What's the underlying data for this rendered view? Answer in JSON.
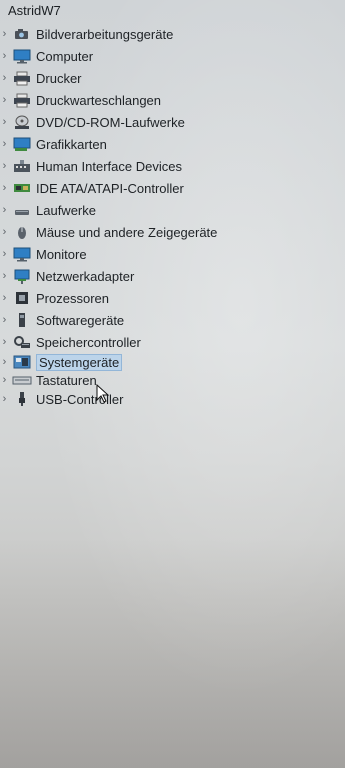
{
  "root": {
    "label": "AstridW7"
  },
  "nodes": [
    {
      "label": "Bildverarbeitungsgeräte",
      "icon": "camera-icon"
    },
    {
      "label": "Computer",
      "icon": "monitor-icon"
    },
    {
      "label": "Drucker",
      "icon": "printer-icon"
    },
    {
      "label": "Druckwarteschlangen",
      "icon": "printer-queue-icon"
    },
    {
      "label": "DVD/CD-ROM-Laufwerke",
      "icon": "disc-drive-icon"
    },
    {
      "label": "Grafikkarten",
      "icon": "display-adapter-icon"
    },
    {
      "label": "Human Interface Devices",
      "icon": "hid-icon"
    },
    {
      "label": "IDE ATA/ATAPI-Controller",
      "icon": "ide-controller-icon"
    },
    {
      "label": "Laufwerke",
      "icon": "disk-drive-icon"
    },
    {
      "label": "Mäuse und andere Zeigegeräte",
      "icon": "mouse-icon"
    },
    {
      "label": "Monitore",
      "icon": "monitor-icon"
    },
    {
      "label": "Netzwerkadapter",
      "icon": "network-adapter-icon"
    },
    {
      "label": "Prozessoren",
      "icon": "cpu-icon"
    },
    {
      "label": "Softwaregeräte",
      "icon": "software-device-icon"
    },
    {
      "label": "Speichercontroller",
      "icon": "storage-controller-icon"
    },
    {
      "label": "Systemgeräte",
      "icon": "system-devices-icon",
      "selected": true
    },
    {
      "label": "Tastaturen",
      "icon": "keyboard-icon"
    },
    {
      "label": "USB-Controller",
      "icon": "usb-icon"
    }
  ],
  "colors": {
    "selection": "#bcd4ea",
    "selection_border": "#93b6d8"
  }
}
